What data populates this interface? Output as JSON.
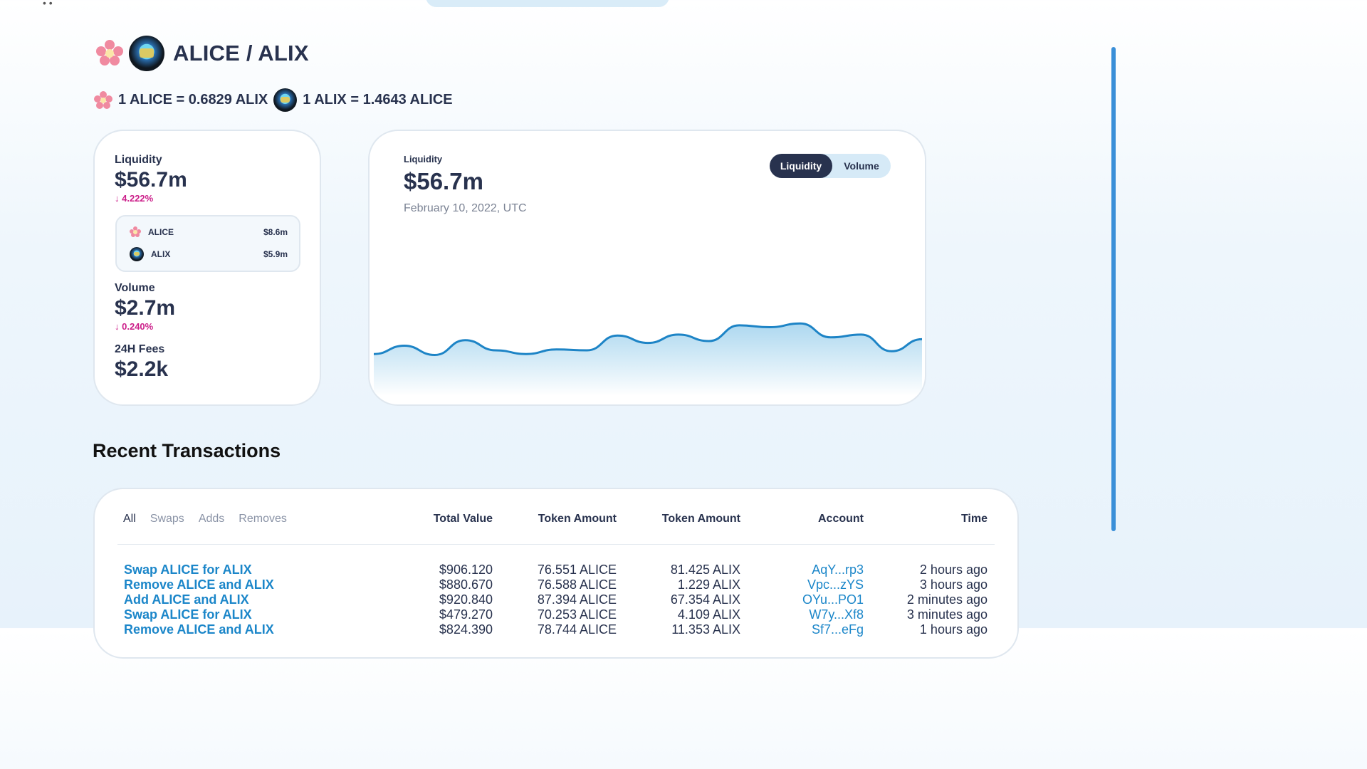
{
  "pair": {
    "title": "ALICE / ALIX",
    "rate_a": "1 ALICE = 0.6829 ALIX",
    "rate_b": "1 ALIX = 1.4643 ALICE"
  },
  "stats": {
    "liquidity_label": "Liquidity",
    "liquidity_value": "$56.7m",
    "liquidity_change": "4.222%",
    "tokens": [
      {
        "symbol": "ALICE",
        "value": "$8.6m",
        "icon": "alice-flower-icon"
      },
      {
        "symbol": "ALIX",
        "value": "$5.9m",
        "icon": "alix-coin-icon"
      }
    ],
    "volume_label": "Volume",
    "volume_value": "$2.7m",
    "volume_change": "0.240%",
    "fees_label": "24H Fees",
    "fees_value": "$2.2k"
  },
  "chart_panel": {
    "label": "Liquidity",
    "value": "$56.7m",
    "date": "February 10, 2022, UTC",
    "toggle": {
      "active": "Liquidity",
      "inactive": "Volume"
    }
  },
  "chart_data": {
    "type": "area",
    "title": "",
    "xlabel": "",
    "ylabel": "",
    "series": [
      {
        "values": [
          54.6,
          55.5,
          54.5,
          56.1,
          55.0,
          54.6,
          55.1,
          55.0,
          56.6,
          55.8,
          56.7,
          56.0,
          57.7,
          57.5,
          57.9,
          56.4,
          56.7,
          54.9,
          56.2
        ]
      }
    ],
    "grid": false,
    "line_color": "#1d84c6",
    "fill_color": "#a9d6ef"
  },
  "transactions": {
    "section_title": "Recent Transactions",
    "filters": [
      "All",
      "Swaps",
      "Adds",
      "Removes"
    ],
    "active_filter": "All",
    "headers": [
      "Total Value",
      "Token Amount",
      "Token Amount",
      "Account",
      "Time"
    ],
    "rows": [
      {
        "action": "Swap ALICE for ALIX",
        "total": "$906.120",
        "amount_a": "76.551 ALICE",
        "amount_b": "81.425 ALIX",
        "account": "AqY...rp3",
        "time": "2 hours ago"
      },
      {
        "action": "Remove ALICE and ALIX",
        "total": "$880.670",
        "amount_a": "76.588 ALICE",
        "amount_b": "1.229 ALIX",
        "account": "Vpc...zYS",
        "time": "3 hours ago"
      },
      {
        "action": "Add ALICE and ALIX",
        "total": "$920.840",
        "amount_a": "87.394 ALICE",
        "amount_b": "67.354 ALIX",
        "account": "OYu...PO1",
        "time": "2 minutes ago"
      },
      {
        "action": "Swap ALICE for ALIX",
        "total": "$479.270",
        "amount_a": "70.253 ALICE",
        "amount_b": "4.109 ALIX",
        "account": "W7y...Xf8",
        "time": "3 minutes ago"
      },
      {
        "action": "Remove ALICE and ALIX",
        "total": "$824.390",
        "amount_a": "78.744 ALICE",
        "amount_b": "11.353 ALIX",
        "account": "Sf7...eFg",
        "time": "1 hours ago"
      }
    ]
  }
}
